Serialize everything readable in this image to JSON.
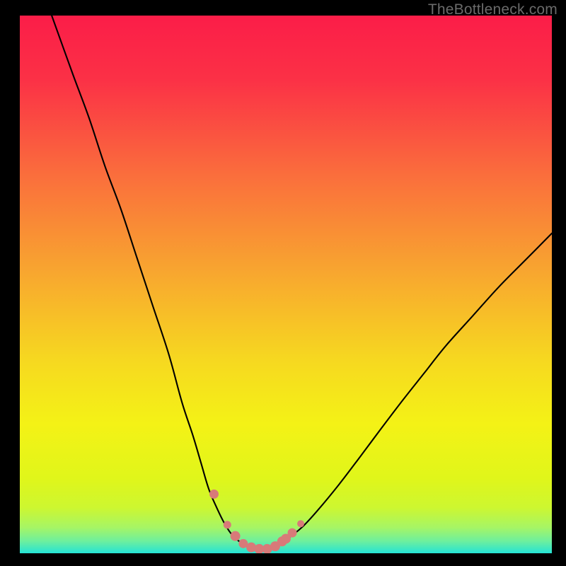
{
  "watermark": "TheBottleneck.com",
  "chart_data": {
    "type": "line",
    "title": "",
    "xlabel": "",
    "ylabel": "",
    "xlim": [
      0,
      100
    ],
    "ylim": [
      0,
      100
    ],
    "grid": false,
    "curve": {
      "x": [
        6,
        10,
        13,
        16,
        19,
        22,
        25,
        28,
        30.5,
        32.5,
        34,
        35.5,
        37,
        38.5,
        40,
        42,
        44,
        46,
        48,
        50,
        53,
        56,
        60,
        64,
        68,
        72,
        76,
        80,
        85,
        90,
        95,
        100
      ],
      "y": [
        100,
        89,
        81,
        72,
        64,
        55,
        46,
        37,
        28,
        22,
        17,
        12,
        8.5,
        5.5,
        3.3,
        1.7,
        0.8,
        0.8,
        1.4,
        2.5,
        4.8,
        8.0,
        12.8,
        18.0,
        23.3,
        28.5,
        33.5,
        38.5,
        44.0,
        49.5,
        54.5,
        59.5
      ]
    },
    "markers": {
      "x": [
        36.5,
        39.0,
        40.5,
        42.0,
        43.5,
        45.0,
        46.5,
        48.0,
        49.3,
        50.0,
        51.2,
        52.8
      ],
      "y": [
        11.0,
        5.3,
        3.2,
        1.8,
        1.1,
        0.8,
        0.8,
        1.3,
        2.2,
        2.7,
        3.8,
        5.5
      ],
      "color": "#d87a79",
      "radius_px": [
        6.5,
        5.5,
        7.0,
        6.5,
        7.0,
        7.0,
        7.0,
        7.0,
        7.0,
        7.0,
        6.5,
        5.0
      ]
    },
    "gradient_stops": [
      {
        "offset": 0.0,
        "color": "#fb1d48"
      },
      {
        "offset": 0.12,
        "color": "#fb3146"
      },
      {
        "offset": 0.3,
        "color": "#fa6f3c"
      },
      {
        "offset": 0.48,
        "color": "#f8a72f"
      },
      {
        "offset": 0.64,
        "color": "#f6d820"
      },
      {
        "offset": 0.76,
        "color": "#f4f216"
      },
      {
        "offset": 0.86,
        "color": "#e0f61a"
      },
      {
        "offset": 0.915,
        "color": "#cdf730"
      },
      {
        "offset": 0.952,
        "color": "#a6f565"
      },
      {
        "offset": 0.978,
        "color": "#6cef9f"
      },
      {
        "offset": 1.0,
        "color": "#24e3d6"
      }
    ]
  }
}
